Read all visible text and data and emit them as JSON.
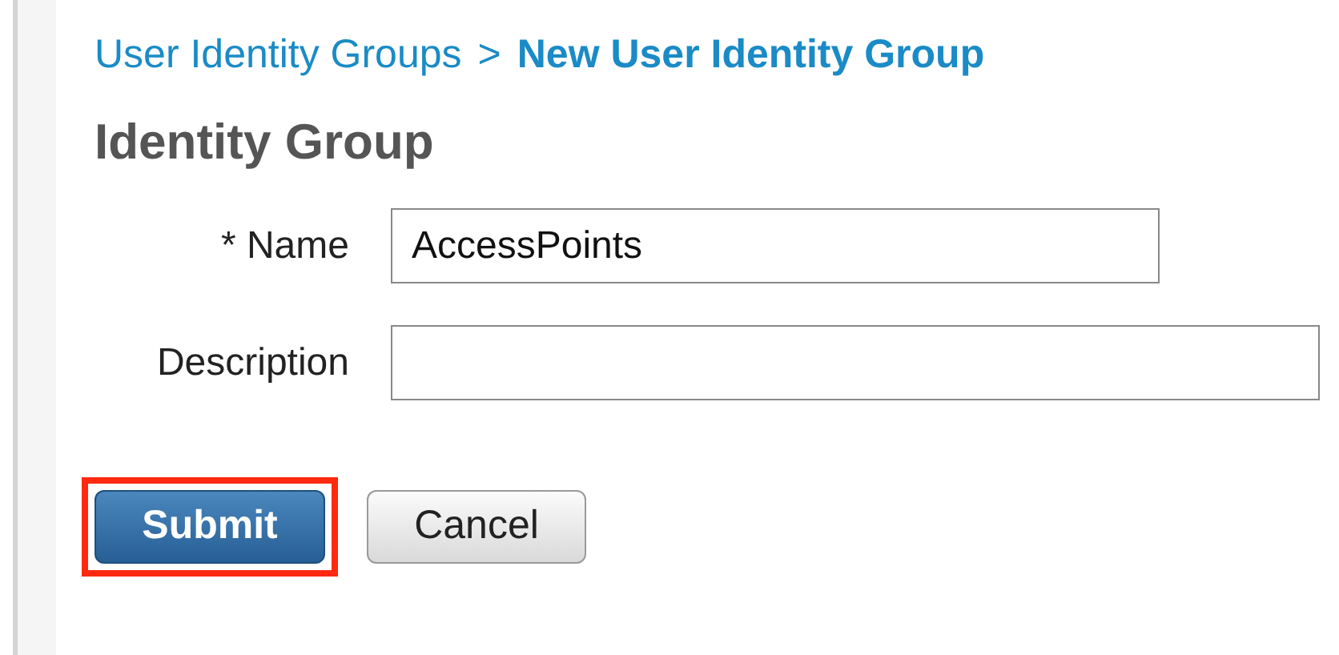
{
  "breadcrumb": {
    "parent": "User Identity Groups",
    "separator": ">",
    "current": "New User Identity Group"
  },
  "heading": "Identity Group",
  "fields": [
    {
      "label": "* Name",
      "value": "AccessPoints"
    },
    {
      "label": "Description"
    }
  ],
  "buttons": [
    {
      "label": "Submit",
      "kind": "primary",
      "highlighted": true
    },
    {
      "label": "Cancel",
      "kind": "secondary",
      "highlighted": false
    }
  ]
}
